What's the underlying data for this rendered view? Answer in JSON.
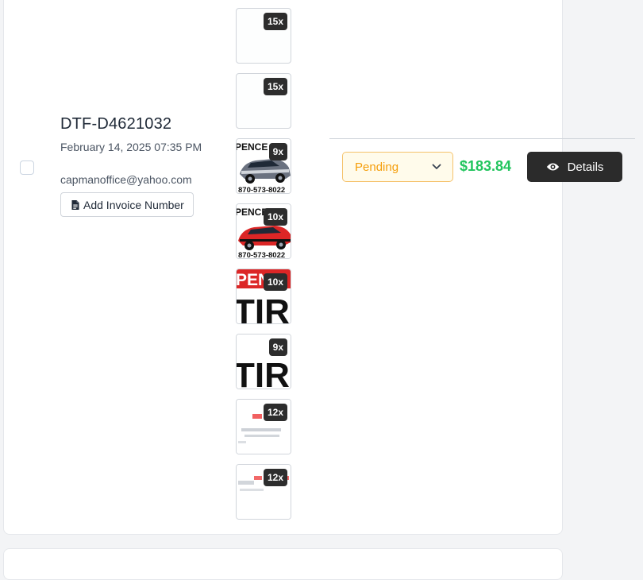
{
  "order": {
    "id": "DTF-D4621032",
    "date": "February 14, 2025 07:35 PM",
    "email": "capmanoffice@yahoo.com",
    "invoice_button_label": "Add Invoice Number",
    "status": "Pending",
    "price": "$183.84",
    "details_label": "Details"
  },
  "items": [
    {
      "qty": "15x",
      "image": "blank-white"
    },
    {
      "qty": "15x",
      "image": "blank-white"
    },
    {
      "qty": "9x",
      "image": "silver-car-with-text"
    },
    {
      "qty": "10x",
      "image": "red-car-with-text"
    },
    {
      "qty": "10x",
      "image": "tire-text-red-banner"
    },
    {
      "qty": "9x",
      "image": "tire-text"
    },
    {
      "qty": "12x",
      "image": "faded-logo"
    },
    {
      "qty": "12x",
      "image": "faded-logo"
    }
  ],
  "thumb_text": {
    "top": "PENCE",
    "phone": "870-573-8022",
    "tire": "TIRE",
    "pence_red": "PENC"
  },
  "colors": {
    "status": "#f59e0b",
    "price": "#22c55e",
    "details_bg": "#2b2b2b"
  }
}
